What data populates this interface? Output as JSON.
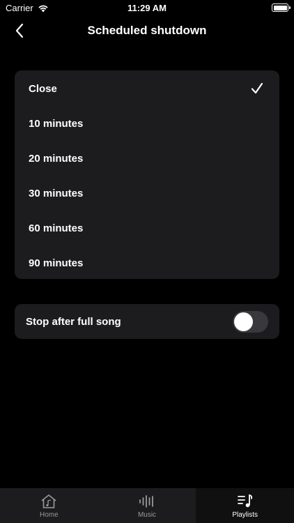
{
  "status_bar": {
    "carrier": "Carrier",
    "time": "11:29 AM"
  },
  "nav": {
    "title": "Scheduled shutdown",
    "back_icon": "chevron-left-icon"
  },
  "timer_options": [
    {
      "label": "Close",
      "selected": true
    },
    {
      "label": "10 minutes",
      "selected": false
    },
    {
      "label": "20 minutes",
      "selected": false
    },
    {
      "label": "30 minutes",
      "selected": false
    },
    {
      "label": "60 minutes",
      "selected": false
    },
    {
      "label": "90 minutes",
      "selected": false
    }
  ],
  "stop_after_full_song": {
    "label": "Stop after full song",
    "enabled": false
  },
  "tab_bar": {
    "tabs": [
      {
        "label": "Home",
        "icon": "home-icon",
        "active": false
      },
      {
        "label": "Music",
        "icon": "waveform-icon",
        "active": false
      },
      {
        "label": "Playlists",
        "icon": "playlist-icon",
        "active": true
      }
    ]
  },
  "colors": {
    "background": "#000000",
    "card": "#1c1c1e",
    "toggle_off": "#39393d",
    "inactive_tab_text": "#9a9a9a"
  }
}
